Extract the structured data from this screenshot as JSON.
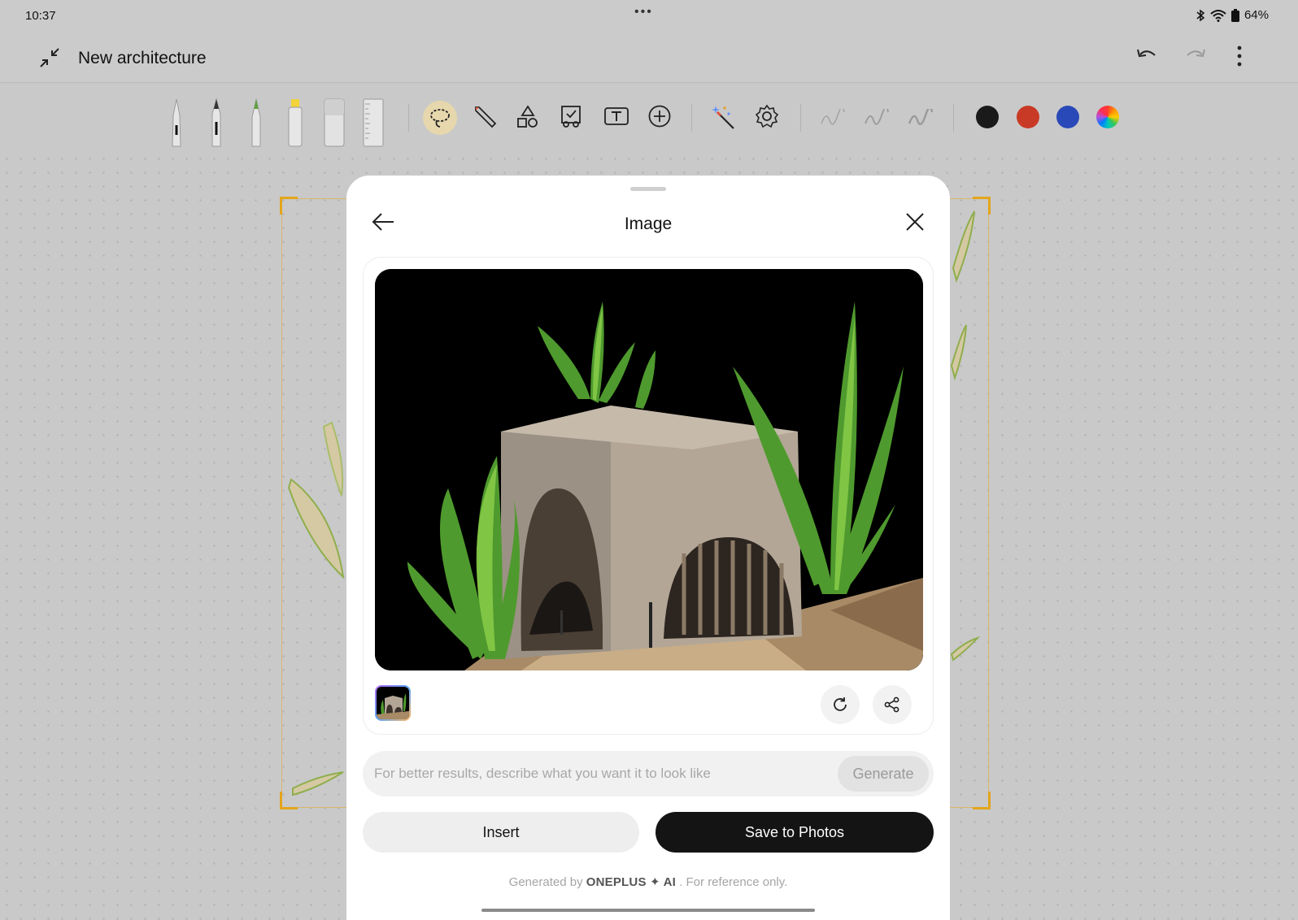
{
  "status_bar": {
    "time": "10:37",
    "battery": "64%"
  },
  "header": {
    "title": "New architecture",
    "collapse_icon": "collapse-icon",
    "undo_icon": "undo-icon",
    "redo_icon": "redo-icon",
    "more_icon": "more-vertical-icon"
  },
  "toolbar": {
    "writing_tools": [
      "ballpoint-pen-icon",
      "fountain-pen-icon",
      "pencil-icon",
      "highlighter-icon",
      "eraser-icon",
      "ruler-icon"
    ],
    "edit_tools": [
      "lasso-icon",
      "brush-icon",
      "shapes-icon",
      "image-select-icon",
      "text-box-icon",
      "add-icon",
      "ai-magic-icon",
      "settings-icon"
    ],
    "stroke_widths": [
      "thin",
      "medium",
      "thick"
    ],
    "colors": [
      "#1a1a1a",
      "#c93a26",
      "#2949b8",
      "rainbow"
    ]
  },
  "dialog": {
    "title": "Image",
    "back_icon": "back-arrow-icon",
    "close_icon": "close-icon",
    "refresh_icon": "refresh-icon",
    "share_icon": "share-icon",
    "prompt_placeholder": "For better results, describe what you want it to look like",
    "generate_label": "Generate",
    "insert_label": "Insert",
    "save_label": "Save to Photos",
    "footer_prefix": "Generated by",
    "footer_brand": "ONEPLUS ✦ AI",
    "footer_suffix": ". For reference only."
  }
}
